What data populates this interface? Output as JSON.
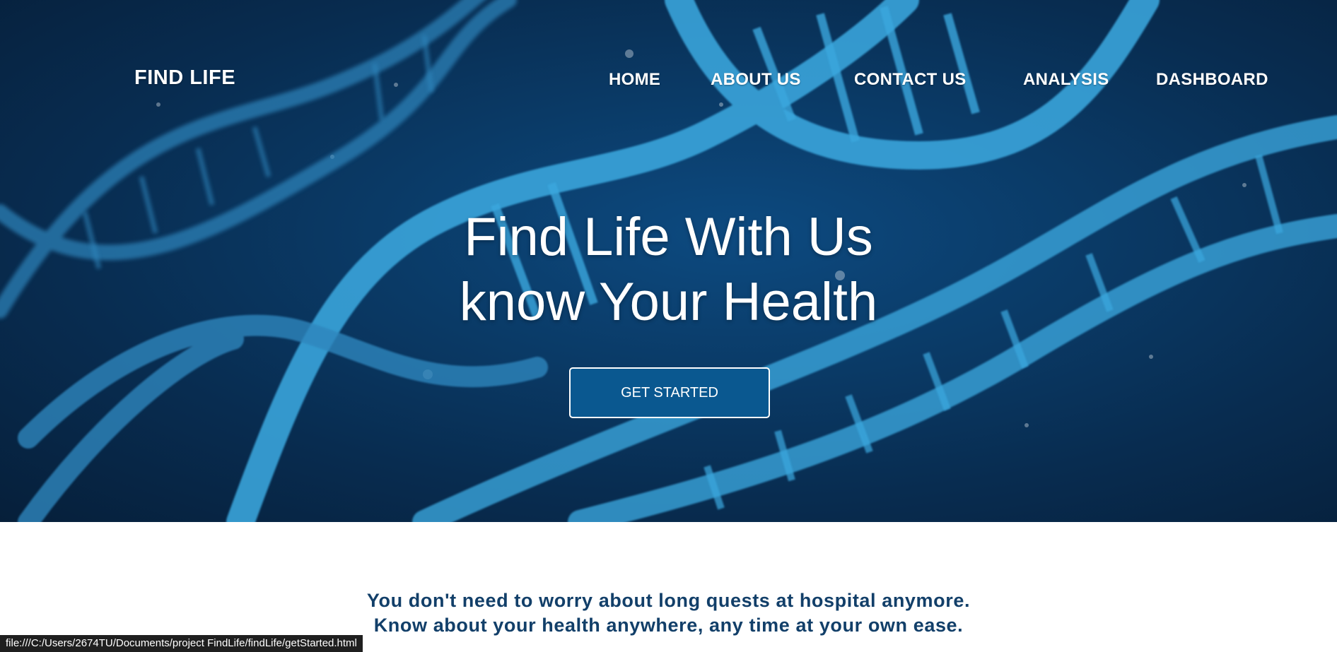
{
  "brand": "FIND LIFE",
  "nav": {
    "home": "HOME",
    "about": "ABOUT US",
    "contact": "CONTACT US",
    "analysis": "ANALYSIS",
    "dashboard": "DASHBOARD"
  },
  "hero": {
    "headline_line1": "Find Life With Us",
    "headline_line2": "know Your Health",
    "cta_label": "GET STARTED"
  },
  "tagline": {
    "line1": "You don't need to worry about long quests at hospital anymore.",
    "line2": "Know about your health anywhere, any time at your own ease."
  },
  "status_bar": {
    "url": "file:///C:/Users/2674TU/Documents/project FindLife/findLife/getStarted.html"
  },
  "colors": {
    "hero_background": "#0a3a66",
    "dna_strand": "#3aa7de",
    "cta_background": "#0a5890",
    "tagline_text": "#123f69"
  }
}
